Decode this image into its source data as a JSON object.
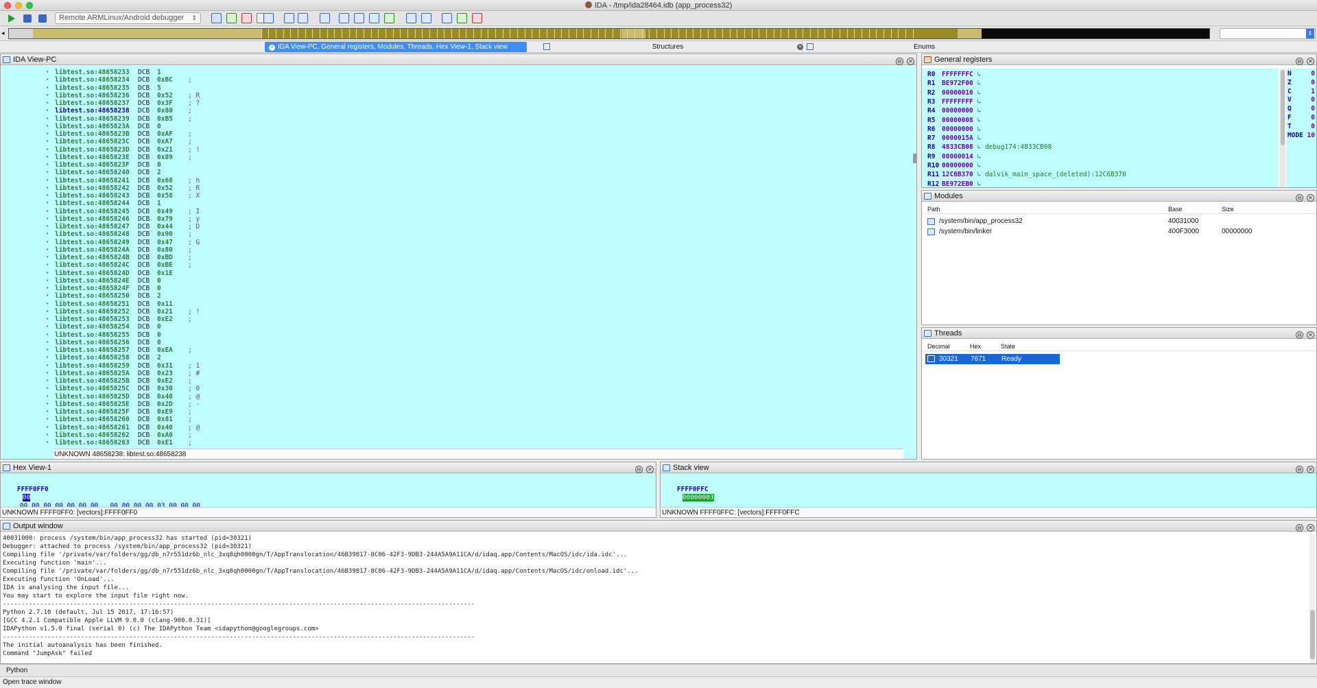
{
  "window": {
    "title": "IDA - /tmp/ida28464.idb (app_process32)"
  },
  "toolbar": {
    "debugger": "Remote ARMLinux/Android debugger"
  },
  "tabs": {
    "main": "IDA View-PC, General registers, Modules, Threads, Hex View-1, Stack view",
    "structures": "Structures",
    "enums": "Enums"
  },
  "ida_view": {
    "title": "IDA View-PC",
    "status": "UNKNOWN  48658238: libtest.so:48658238",
    "lines": [
      {
        "a": "libtest.so:48658233",
        "v": "1",
        "c": ""
      },
      {
        "a": "libtest.so:48658234",
        "v": "0xBC",
        "c": ";"
      },
      {
        "a": "libtest.so:48658235",
        "v": "5",
        "c": ""
      },
      {
        "a": "libtest.so:48658236",
        "v": "0x52",
        "c": "; R"
      },
      {
        "a": "libtest.so:48658237",
        "v": "0x3F",
        "c": "; ?"
      },
      {
        "a": "libtest.so:48658238",
        "v": "0x80",
        "c": ";"
      },
      {
        "a": "libtest.so:48658239",
        "v": "0xB5",
        "c": ";"
      },
      {
        "a": "libtest.so:4865823A",
        "v": "0",
        "c": ""
      },
      {
        "a": "libtest.so:4865823B",
        "v": "0xAF",
        "c": ";"
      },
      {
        "a": "libtest.so:4865823C",
        "v": "0xA7",
        "c": ";"
      },
      {
        "a": "libtest.so:4865823D",
        "v": "0x21",
        "c": "; !"
      },
      {
        "a": "libtest.so:4865823E",
        "v": "0x89",
        "c": ";"
      },
      {
        "a": "libtest.so:4865823F",
        "v": "0",
        "c": ""
      },
      {
        "a": "libtest.so:48658240",
        "v": "2",
        "c": ""
      },
      {
        "a": "libtest.so:48658241",
        "v": "0x68",
        "c": "; h"
      },
      {
        "a": "libtest.so:48658242",
        "v": "0x52",
        "c": "; R"
      },
      {
        "a": "libtest.so:48658243",
        "v": "0x58",
        "c": "; X"
      },
      {
        "a": "libtest.so:48658244",
        "v": "1",
        "c": ""
      },
      {
        "a": "libtest.so:48658245",
        "v": "0x49",
        "c": "; I"
      },
      {
        "a": "libtest.so:48658246",
        "v": "0x79",
        "c": "; y"
      },
      {
        "a": "libtest.so:48658247",
        "v": "0x44",
        "c": "; D"
      },
      {
        "a": "libtest.so:48658248",
        "v": "0x90",
        "c": ";"
      },
      {
        "a": "libtest.so:48658249",
        "v": "0x47",
        "c": "; G"
      },
      {
        "a": "libtest.so:4865824A",
        "v": "0x80",
        "c": ";"
      },
      {
        "a": "libtest.so:4865824B",
        "v": "0xBD",
        "c": ";"
      },
      {
        "a": "libtest.so:4865824C",
        "v": "0xBE",
        "c": ";"
      },
      {
        "a": "libtest.so:4865824D",
        "v": "0x1E",
        "c": ""
      },
      {
        "a": "libtest.so:4865824E",
        "v": "0",
        "c": ""
      },
      {
        "a": "libtest.so:4865824F",
        "v": "0",
        "c": ""
      },
      {
        "a": "libtest.so:48658250",
        "v": "2",
        "c": ""
      },
      {
        "a": "libtest.so:48658251",
        "v": "0x11",
        "c": ""
      },
      {
        "a": "libtest.so:48658252",
        "v": "0x21",
        "c": "; !"
      },
      {
        "a": "libtest.so:48658253",
        "v": "0xE2",
        "c": ";"
      },
      {
        "a": "libtest.so:48658254",
        "v": "0",
        "c": ""
      },
      {
        "a": "libtest.so:48658255",
        "v": "0",
        "c": ""
      },
      {
        "a": "libtest.so:48658256",
        "v": "0",
        "c": ""
      },
      {
        "a": "libtest.so:48658257",
        "v": "0xEA",
        "c": ";"
      },
      {
        "a": "libtest.so:48658258",
        "v": "2",
        "c": ""
      },
      {
        "a": "libtest.so:48658259",
        "v": "0x31",
        "c": "; 1"
      },
      {
        "a": "libtest.so:4865825A",
        "v": "0x23",
        "c": "; #"
      },
      {
        "a": "libtest.so:4865825B",
        "v": "0xE2",
        "c": ";"
      },
      {
        "a": "libtest.so:4865825C",
        "v": "0x30",
        "c": "; 0"
      },
      {
        "a": "libtest.so:4865825D",
        "v": "0x40",
        "c": "; @"
      },
      {
        "a": "libtest.so:4865825E",
        "v": "0x2D",
        "c": "; -"
      },
      {
        "a": "libtest.so:4865825F",
        "v": "0xE9",
        "c": ";"
      },
      {
        "a": "libtest.so:48658260",
        "v": "0x81",
        "c": ";"
      },
      {
        "a": "libtest.so:48658261",
        "v": "0x40",
        "c": "; @"
      },
      {
        "a": "libtest.so:48658262",
        "v": "0xA0",
        "c": ";"
      },
      {
        "a": "libtest.so:48658263",
        "v": "0xE1",
        "c": ";"
      }
    ]
  },
  "registers": {
    "title": "General registers",
    "items": [
      {
        "n": "R0",
        "v": "FFFFFFFC",
        "d": ""
      },
      {
        "n": "R1",
        "v": "BE972F00",
        "d": ""
      },
      {
        "n": "R2",
        "v": "00000010",
        "d": ""
      },
      {
        "n": "R3",
        "v": "FFFFFFFF",
        "d": ""
      },
      {
        "n": "R4",
        "v": "00000000",
        "d": ""
      },
      {
        "n": "R5",
        "v": "00000008",
        "d": ""
      },
      {
        "n": "R6",
        "v": "00000000",
        "d": ""
      },
      {
        "n": "R7",
        "v": "0000015A",
        "d": ""
      },
      {
        "n": "R8",
        "v": "4833CB08",
        "d": "debug174:4833CB08"
      },
      {
        "n": "R9",
        "v": "00000014",
        "d": ""
      },
      {
        "n": "R10",
        "v": "00000000",
        "d": ""
      },
      {
        "n": "R11",
        "v": "12C6B370",
        "d": "dalvik_main_space_(deleted):12C6B370"
      },
      {
        "n": "R12",
        "v": "BE972EB0",
        "d": ""
      }
    ],
    "flags": [
      {
        "n": "N",
        "v": "0"
      },
      {
        "n": "Z",
        "v": "0"
      },
      {
        "n": "C",
        "v": "1"
      },
      {
        "n": "V",
        "v": "0"
      },
      {
        "n": "Q",
        "v": "0"
      },
      {
        "n": "F",
        "v": "0"
      },
      {
        "n": "T",
        "v": "0"
      },
      {
        "n": "MODE",
        "v": "10"
      }
    ]
  },
  "modules": {
    "title": "Modules",
    "headers": [
      "Path",
      "Base",
      "Size"
    ],
    "rows": [
      {
        "path": "/system/bin/app_process32",
        "base": "40031000",
        "size": ""
      },
      {
        "path": "/system/bin/linker",
        "base": "400F3000",
        "size": "00000000"
      }
    ]
  },
  "threads": {
    "title": "Threads",
    "headers": [
      "Decimal",
      "Hex",
      "State"
    ],
    "rows": [
      {
        "dec": "30321",
        "hex": "7671",
        "state": "Ready"
      }
    ]
  },
  "hex_view": {
    "title": "Hex View-1",
    "addr": "FFFF0FF0",
    "first": "00",
    "bytes": "00 00 00 00 00 00 00   00 00 00 00 03 00 00 00",
    "ascii": "................",
    "status": "UNKNOWN  FFFF0FF0: [vectors]:FFFF0FF0"
  },
  "stack_view": {
    "title": "Stack view",
    "addr": "FFFF0FFC",
    "value": "00000003",
    "status": "UNKNOWN  FFFF0FFC: [vectors]:FFFF0FFC"
  },
  "output": {
    "title": "Output window",
    "lines": [
      "40031000: process /system/bin/app_process32 has started (pid=30321)",
      "Debugger: attached to process /system/bin/app_process32 (pid=30321)",
      "Compiling file '/private/var/folders/gg/db_n7r551dz6b_nlc_3xq8qh0000gn/T/AppTranslocation/46B39817-8C06-42F3-9DB3-244A5A9A11CA/d/idaq.app/Contents/MacOS/idc/ida.idc'...",
      "Executing function 'main'...",
      "Compiling file '/private/var/folders/gg/db_n7r551dz6b_nlc_3xq8qh0000gn/T/AppTranslocation/46B39817-8C06-42F3-9DB3-244A5A9A11CA/d/idaq.app/Contents/MacOS/idc/onload.idc'...",
      "Executing function 'OnLoad'...",
      "IDA is analysing the input file...",
      "You may start to explore the input file right now.",
      "-------------------------------------------------------------------------------------------------------------------------------",
      "Python 2.7.10 (default, Jul 15 2017, 17:16:57)",
      "[GCC 4.2.1 Compatible Apple LLVM 9.0.0 (clang-900.0.31)]",
      "IDAPython v1.5.0 final (serial 0) (c) The IDAPython Team <idapython@googlegroups.com>",
      "-------------------------------------------------------------------------------------------------------------------------------",
      "The initial autoanalysis has been finished.",
      "Command \"JumpAsk\" failed"
    ]
  },
  "python_tab": "Python",
  "status_bar": "Open trace window"
}
